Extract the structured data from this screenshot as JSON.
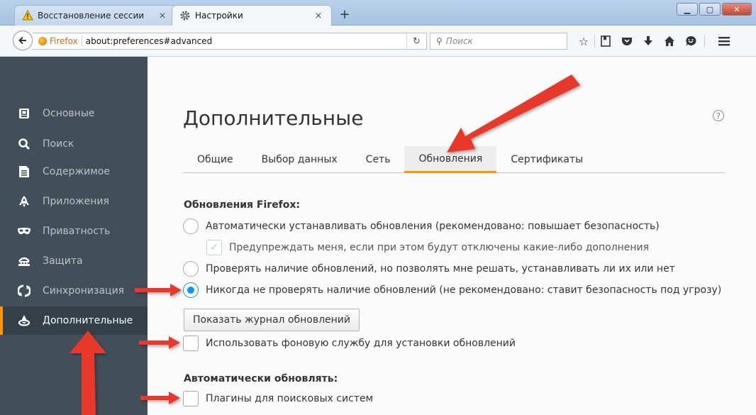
{
  "browser": {
    "tabs": [
      {
        "label": "Восстановление сессии",
        "icon": "warning-icon",
        "active": false
      },
      {
        "label": "Настройки",
        "icon": "gear-icon",
        "active": true
      }
    ],
    "tab_close": "×",
    "new_tab": "+",
    "url_brand": "Firefox",
    "url": "about:preferences#advanced",
    "search_placeholder": "Поиск"
  },
  "sidebar": {
    "items": [
      {
        "label": "Основные",
        "icon": "general-icon",
        "selected": false
      },
      {
        "label": "Поиск",
        "icon": "search-icon",
        "selected": false
      },
      {
        "label": "Содержимое",
        "icon": "content-icon",
        "selected": false
      },
      {
        "label": "Приложения",
        "icon": "rocket-icon",
        "selected": false
      },
      {
        "label": "Приватность",
        "icon": "mask-icon",
        "selected": false
      },
      {
        "label": "Защита",
        "icon": "security-icon",
        "selected": false
      },
      {
        "label": "Синхронизация",
        "icon": "sync-icon",
        "selected": false
      },
      {
        "label": "Дополнительные",
        "icon": "wizard-icon",
        "selected": true
      }
    ]
  },
  "main": {
    "title": "Дополнительные",
    "help": "?",
    "tabs": [
      {
        "label": "Общие",
        "active": false
      },
      {
        "label": "Выбор данных",
        "active": false
      },
      {
        "label": "Сеть",
        "active": false
      },
      {
        "label": "Обновления",
        "active": true
      },
      {
        "label": "Сертификаты",
        "active": false
      }
    ],
    "updates_heading": "Обновления Firefox:",
    "options": {
      "auto_install": "Автоматически устанавливать обновления (рекомендовано: повышает безопасность)",
      "warn_addons": "Предупреждать меня, если при этом будут отключены какие-либо дополнения",
      "check_let_choose": "Проверять наличие обновлений, но позволять мне решать, устанавливать ли их или нет",
      "never_check": "Никогда не проверять наличие обновлений (не рекомендовано: ставит безопасность под угрозу)"
    },
    "selected_option": "never_check",
    "show_history_button": "Показать журнал обновлений",
    "background_service": "Использовать фоновую службу для установки обновлений",
    "auto_update_heading": "Автоматически обновлять:",
    "search_plugins": "Плагины для поисковых систем"
  },
  "colors": {
    "accent_orange": "#ff9500",
    "radio_blue": "#0996f8",
    "sidebar_bg": "#424f5a",
    "annotation_red": "#e8372c"
  }
}
